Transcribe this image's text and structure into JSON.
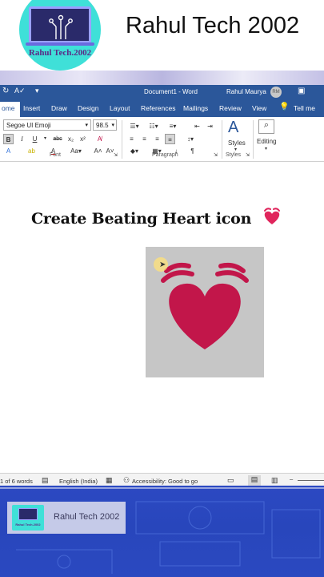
{
  "channel": {
    "name": "Rahul Tech 2002",
    "logo_text": "Rahul Tech.2002",
    "logo_icon": "circuit-monitor-icon",
    "accent": "#3fe0d8"
  },
  "word": {
    "title": "Document1  -  Word",
    "user_name": "Rahul Maurya",
    "user_initials": "RM",
    "tabs": [
      "ome",
      "Insert",
      "Draw",
      "Design",
      "Layout",
      "References",
      "Mailings",
      "Review",
      "View"
    ],
    "tell_me": "Tell me",
    "font_name": "Segoe UI Emoji",
    "font_size": "98.5",
    "groups": {
      "font": "Font",
      "paragraph": "Paragraph",
      "styles": "Styles"
    },
    "styles_label": "Styles",
    "editing_label": "Editing",
    "brand_color": "#2b579a"
  },
  "document": {
    "heading": "Create Beating Heart icon",
    "heading_emoji": "heart-beating-icon",
    "heart_color": "#c2164a"
  },
  "status": {
    "words": "1 of 6 words",
    "language": "English (India)",
    "accessibility": "Accessibility: Good to go"
  },
  "banner": {
    "brand_name": "Rahul Tech 2002",
    "brand_logo_text": "Rahul Tech.2002",
    "background": "#2a48bf"
  }
}
